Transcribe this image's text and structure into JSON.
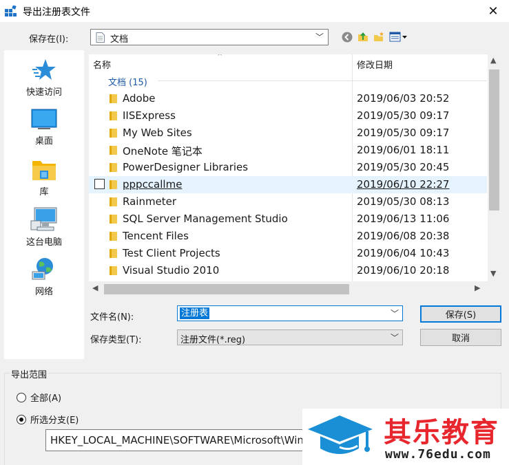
{
  "window": {
    "title": "导出注册表文件",
    "close_glyph": "✕"
  },
  "save_in": {
    "label": "保存在(I):",
    "value": "文档"
  },
  "places": [
    {
      "label": "快速访问",
      "icon": "star-icon"
    },
    {
      "label": "桌面",
      "icon": "desktop-icon"
    },
    {
      "label": "库",
      "icon": "library-icon"
    },
    {
      "label": "这台电脑",
      "icon": "computer-icon"
    },
    {
      "label": "网络",
      "icon": "network-icon"
    }
  ],
  "file_list": {
    "columns": [
      "名称",
      "修改日期"
    ],
    "group": "文档 (15)",
    "rows": [
      {
        "name": "Adobe",
        "date": "2019/06/03 20:52"
      },
      {
        "name": "IISExpress",
        "date": "2019/05/30 09:17"
      },
      {
        "name": "My Web Sites",
        "date": "2019/05/30 09:17"
      },
      {
        "name": "OneNote 笔记本",
        "date": "2019/06/01 18:11"
      },
      {
        "name": "PowerDesigner Libraries",
        "date": "2019/05/30 20:45"
      },
      {
        "name": "pppccallme",
        "date": "2019/06/10 22:27"
      },
      {
        "name": "Rainmeter",
        "date": "2019/05/30 08:13"
      },
      {
        "name": "SQL Server Management Studio",
        "date": "2019/06/13 11:06"
      },
      {
        "name": "Tencent Files",
        "date": "2019/06/08 20:38"
      },
      {
        "name": "Test Client Projects",
        "date": "2019/06/04 10:43"
      },
      {
        "name": "Visual Studio 2010",
        "date": "2019/06/10 20:18"
      }
    ]
  },
  "filename": {
    "label": "文件名(N):",
    "value": "注册表"
  },
  "filetype": {
    "label": "保存类型(T):",
    "value": "注册文件(*.reg)"
  },
  "buttons": {
    "save": "保存(S)",
    "cancel": "取消"
  },
  "export_range": {
    "title": "导出范围",
    "all_label": "全部(A)",
    "selected_label": "所选分支(E)",
    "selected_checked": true,
    "branch_path": "HKEY_LOCAL_MACHINE\\SOFTWARE\\Microsoft\\Windows"
  },
  "watermark": {
    "title": "其乐教育",
    "url": "www.76edu.com"
  }
}
